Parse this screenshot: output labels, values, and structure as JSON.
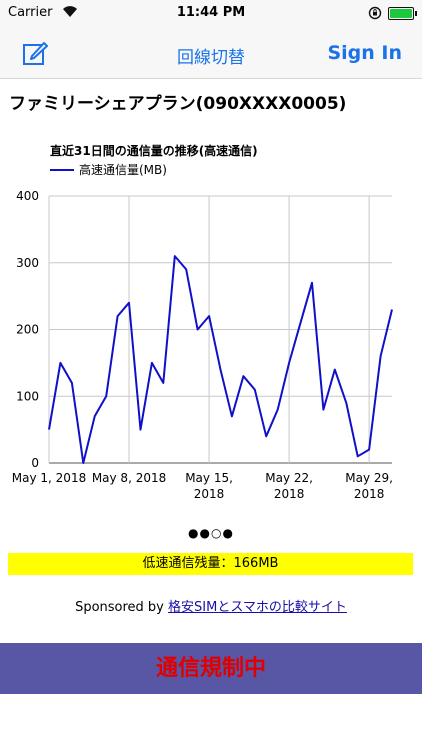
{
  "status_bar": {
    "carrier": "Carrier",
    "time": "11:44 PM",
    "battery_level": 1.0
  },
  "nav_bar": {
    "title": "回線切替",
    "sign_in_label": "Sign In",
    "accent_color": "#1a73e8"
  },
  "plan": {
    "title": "ファミリーシェアプラン(090XXXX0005)"
  },
  "chart_data": {
    "type": "line",
    "title": "直近31日間の通信量の推移(高速通信)",
    "xlabel": "",
    "ylabel": "",
    "ylim": [
      0,
      400
    ],
    "yticks": [
      "0",
      "100",
      "200",
      "300",
      "400"
    ],
    "xtick_labels": [
      {
        "day": 0,
        "lines": [
          "May 1, 2018"
        ]
      },
      {
        "day": 7,
        "lines": [
          "May 8, 2018"
        ]
      },
      {
        "day": 14,
        "lines": [
          "May 15,",
          "2018"
        ]
      },
      {
        "day": 21,
        "lines": [
          "May 22,",
          "2018"
        ]
      },
      {
        "day": 28,
        "lines": [
          "May 29,",
          "2018"
        ]
      }
    ],
    "grid": true,
    "legend": "top-left",
    "series": [
      {
        "name": "高速通信量(MB)",
        "color": "#1010c8",
        "x": [
          0,
          1,
          2,
          3,
          4,
          5,
          6,
          7,
          8,
          9,
          10,
          11,
          12,
          13,
          14,
          15,
          16,
          17,
          18,
          19,
          20,
          21,
          22,
          23,
          24,
          25,
          26,
          27,
          28,
          29,
          30
        ],
        "values": [
          50,
          150,
          120,
          0,
          70,
          100,
          220,
          240,
          50,
          150,
          120,
          310,
          290,
          200,
          220,
          140,
          70,
          130,
          110,
          40,
          80,
          150,
          210,
          270,
          80,
          140,
          90,
          10,
          20,
          160,
          230
        ]
      }
    ]
  },
  "pager": {
    "dots": "●●○●"
  },
  "low_speed": {
    "label": "低速通信残量：166MB"
  },
  "sponsor": {
    "prefix": "Sponsored by ",
    "link_text": "格安SIMとスマホの比較サイト"
  },
  "restriction": {
    "label": "通信規制中"
  }
}
